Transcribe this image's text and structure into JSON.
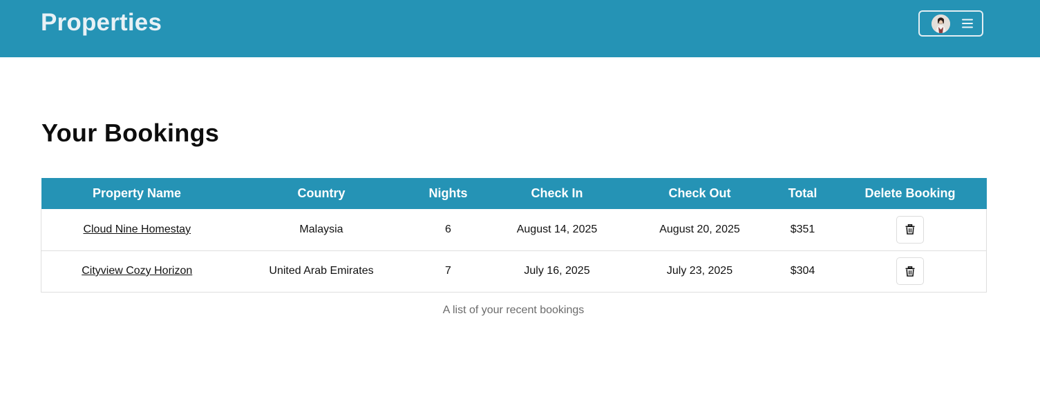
{
  "navbar": {
    "brand": "Properties",
    "bg_color": "#2593b5",
    "user_menu": {
      "avatar_icon": "user-avatar",
      "menu_icon": "hamburger-icon"
    }
  },
  "main": {
    "heading": "Your Bookings",
    "table": {
      "columns": [
        "Property Name",
        "Country",
        "Nights",
        "Check In",
        "Check Out",
        "Total",
        "Delete Booking"
      ],
      "rows": [
        {
          "property": "Cloud Nine Homestay",
          "country": "Malaysia",
          "nights": "6",
          "check_in": "August 14, 2025",
          "check_out": "August 20, 2025",
          "total": "$351",
          "delete_icon": "trash-icon"
        },
        {
          "property": "Cityview Cozy Horizon",
          "country": "United Arab Emirates",
          "nights": "7",
          "check_in": "July 16, 2025",
          "check_out": "July 23, 2025",
          "total": "$304",
          "delete_icon": "trash-icon"
        }
      ]
    },
    "caption": "A list of your recent bookings"
  }
}
